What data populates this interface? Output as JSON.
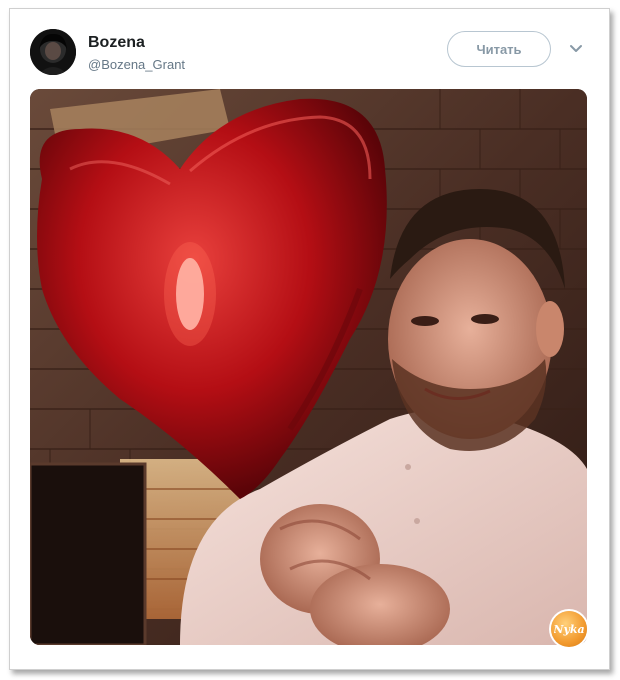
{
  "tweet": {
    "author_name": "Bozena",
    "author_handle": "@Bozena_Grant",
    "follow_label": "Читать",
    "menu_icon": "chevron-down-icon",
    "avatar_icon": "avatar",
    "photo_description_icon": "tweet-photo"
  },
  "watermark": {
    "text": "Nyka"
  },
  "colors": {
    "name": "#1c2022",
    "handle": "#657786",
    "button_border": "#b8c6d1",
    "button_text": "#8899a6",
    "balloon": "#c4141a",
    "watermark": "#f29a2e"
  }
}
